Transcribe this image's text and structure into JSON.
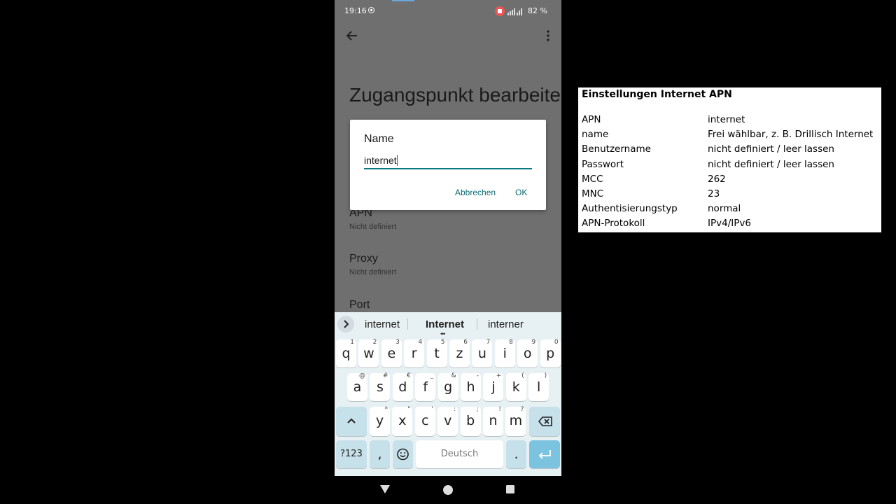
{
  "statusbar": {
    "time": "19:16",
    "battery": "82 %"
  },
  "screen": {
    "title": "Zugangspunkt bearbeiten"
  },
  "settings": [
    {
      "label": "APN",
      "value": "Nicht definiert"
    },
    {
      "label": "Proxy",
      "value": "Nicht definiert"
    },
    {
      "label": "Port",
      "value": ""
    }
  ],
  "dialog": {
    "title": "Name",
    "input_value": "internet",
    "cancel_label": "Abbrechen",
    "ok_label": "OK"
  },
  "keyboard": {
    "suggestions": [
      "internet",
      "Internet",
      "interner"
    ],
    "row1": [
      [
        "q",
        "1"
      ],
      [
        "w",
        "2"
      ],
      [
        "e",
        "3"
      ],
      [
        "r",
        "4"
      ],
      [
        "t",
        "5"
      ],
      [
        "z",
        "6"
      ],
      [
        "u",
        "7"
      ],
      [
        "i",
        "8"
      ],
      [
        "o",
        "9"
      ],
      [
        "p",
        "0"
      ]
    ],
    "row2": [
      [
        "a",
        "@"
      ],
      [
        "s",
        "#"
      ],
      [
        "d",
        "€"
      ],
      [
        "f",
        "_"
      ],
      [
        "g",
        "&"
      ],
      [
        "h",
        "-"
      ],
      [
        "j",
        "+"
      ],
      [
        "k",
        "("
      ],
      [
        "l",
        ")"
      ]
    ],
    "row3": [
      [
        "y",
        "*"
      ],
      [
        "x",
        "\""
      ],
      [
        "c",
        "'"
      ],
      [
        "v",
        ":"
      ],
      [
        "b",
        ";"
      ],
      [
        "n",
        "!"
      ],
      [
        "m",
        "?"
      ]
    ],
    "symbols_label": "?123",
    "comma": ",",
    "space_label": "Deutsch",
    "period": "."
  },
  "info_panel": {
    "title": "Einstellungen Internet APN",
    "rows": [
      {
        "key": "APN",
        "value": "internet"
      },
      {
        "key": "name",
        "value": "Frei wählbar, z. B. Drillisch Internet"
      },
      {
        "key": "Benutzername",
        "value": "nicht definiert / leer lassen"
      },
      {
        "key": "Passwort",
        "value": "nicht definiert / leer lassen"
      },
      {
        "key": "MCC",
        "value": "262"
      },
      {
        "key": "MNC",
        "value": "23"
      },
      {
        "key": "Authentisierungstyp",
        "value": "normal"
      },
      {
        "key": "APN-Protokoll",
        "value": "IPv4/IPv6"
      }
    ]
  }
}
